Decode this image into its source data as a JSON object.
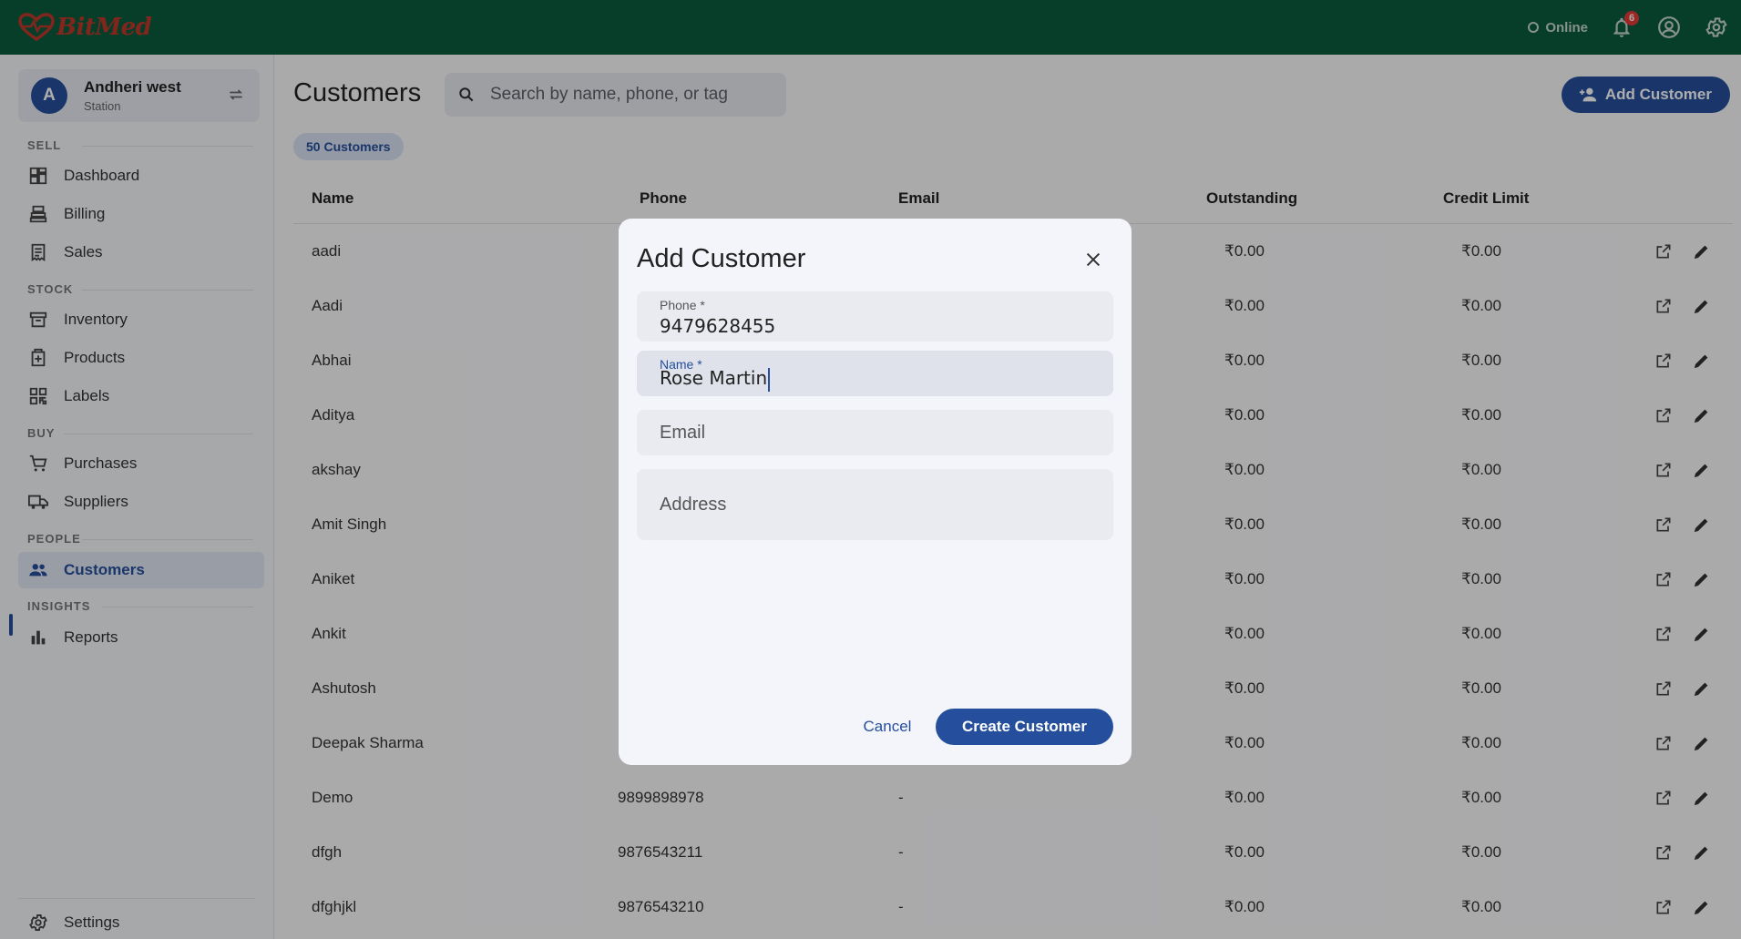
{
  "app": {
    "brand": "BitMed",
    "status": "Online",
    "notifications_count": "6"
  },
  "station": {
    "avatar_letter": "A",
    "name": "Andheri west",
    "type": "Station"
  },
  "nav": {
    "sections": {
      "sell": "SELL",
      "stock": "STOCK",
      "buy": "BUY",
      "people": "PEOPLE",
      "insights": "INSIGHTS"
    },
    "items": {
      "dashboard": "Dashboard",
      "billing": "Billing",
      "sales": "Sales",
      "inventory": "Inventory",
      "products": "Products",
      "labels": "Labels",
      "purchases": "Purchases",
      "suppliers": "Suppliers",
      "customers": "Customers",
      "reports": "Reports",
      "settings": "Settings"
    },
    "active": "customers"
  },
  "page": {
    "title": "Customers",
    "search_placeholder": "Search by name, phone, or tag",
    "add_button": "Add Customer",
    "count_badge": "50 Customers"
  },
  "table": {
    "columns": {
      "name": "Name",
      "phone": "Phone",
      "email": "Email",
      "outstanding": "Outstanding",
      "credit_limit": "Credit Limit"
    },
    "rows": [
      {
        "name": "aadi",
        "phone": "",
        "email": "",
        "outstanding": "₹0.00",
        "credit_limit": "₹0.00"
      },
      {
        "name": "Aadi",
        "phone": "",
        "email": "",
        "outstanding": "₹0.00",
        "credit_limit": "₹0.00"
      },
      {
        "name": "Abhai",
        "phone": "",
        "email": "",
        "outstanding": "₹0.00",
        "credit_limit": "₹0.00"
      },
      {
        "name": "Aditya",
        "phone": "",
        "email": "",
        "outstanding": "₹0.00",
        "credit_limit": "₹0.00"
      },
      {
        "name": "akshay",
        "phone": "",
        "email": "",
        "outstanding": "₹0.00",
        "credit_limit": "₹0.00"
      },
      {
        "name": "Amit Singh",
        "phone": "",
        "email": "",
        "outstanding": "₹0.00",
        "credit_limit": "₹0.00"
      },
      {
        "name": "Aniket",
        "phone": "",
        "email": "",
        "outstanding": "₹0.00",
        "credit_limit": "₹0.00"
      },
      {
        "name": "Ankit",
        "phone": "",
        "email": "",
        "outstanding": "₹0.00",
        "credit_limit": "₹0.00"
      },
      {
        "name": "Ashutosh",
        "phone": "",
        "email": "",
        "outstanding": "₹0.00",
        "credit_limit": "₹0.00"
      },
      {
        "name": "Deepak Sharma",
        "phone": "",
        "email": "",
        "outstanding": "₹0.00",
        "credit_limit": "₹0.00"
      },
      {
        "name": "Demo",
        "phone": "9899898978",
        "email": "-",
        "outstanding": "₹0.00",
        "credit_limit": "₹0.00"
      },
      {
        "name": "dfgh",
        "phone": "9876543211",
        "email": "-",
        "outstanding": "₹0.00",
        "credit_limit": "₹0.00"
      },
      {
        "name": "dfghjkl",
        "phone": "9876543210",
        "email": "-",
        "outstanding": "₹0.00",
        "credit_limit": "₹0.00"
      }
    ]
  },
  "modal": {
    "title": "Add Customer",
    "phone_label": "Phone *",
    "phone_value": "9479628455",
    "name_label": "Name *",
    "name_value": "Rose Martin",
    "email_placeholder": "Email",
    "address_placeholder": "Address",
    "cancel": "Cancel",
    "create": "Create Customer"
  },
  "colors": {
    "topbar": "#0a5c3f",
    "accent": "#254f9c",
    "brand": "#c0392b"
  }
}
